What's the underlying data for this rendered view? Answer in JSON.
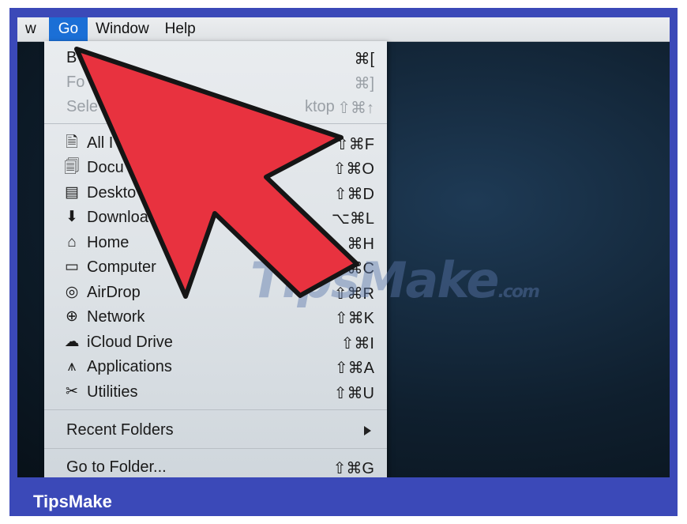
{
  "menubar": {
    "items": [
      "w",
      "Go",
      "Window",
      "Help"
    ]
  },
  "menu": {
    "items": [
      {
        "label": "B",
        "shortcut": "⌘[",
        "dim": false
      },
      {
        "label": "Fo",
        "shortcut": "⌘]",
        "dim": true
      },
      {
        "label": "Sele",
        "label_tail": "ktop",
        "shortcut": "⇧⌘↑",
        "dim": true
      },
      {
        "icon": "all-files-icon",
        "glyph": "🗎",
        "label": "All I",
        "shortcut": "⇧⌘F"
      },
      {
        "icon": "documents-icon",
        "glyph": "🗐",
        "label": "Docu",
        "shortcut": "⇧⌘O"
      },
      {
        "icon": "desktop-icon",
        "glyph": "▤",
        "label": "Deskto",
        "shortcut": "⇧⌘D"
      },
      {
        "icon": "downloads-icon",
        "glyph": "⬇",
        "label": "Downloa",
        "shortcut": "⌥⌘L"
      },
      {
        "icon": "home-icon",
        "glyph": "⌂",
        "label": "Home",
        "shortcut": "⌘H"
      },
      {
        "icon": "computer-icon",
        "glyph": "▭",
        "label": "Computer",
        "shortcut": "⌘C"
      },
      {
        "icon": "airdrop-icon",
        "glyph": "◎",
        "label": "AirDrop",
        "shortcut": "⇧⌘R"
      },
      {
        "icon": "network-icon",
        "glyph": "⊕",
        "label": "Network",
        "shortcut": "⇧⌘K"
      },
      {
        "icon": "icloud-icon",
        "glyph": "☁",
        "label": "iCloud Drive",
        "shortcut": "⇧⌘I"
      },
      {
        "icon": "applications-icon",
        "glyph": "⩚",
        "label": "Applications",
        "shortcut": "⇧⌘A"
      },
      {
        "icon": "utilities-icon",
        "glyph": "✂",
        "label": "Utilities",
        "shortcut": "⇧⌘U"
      },
      {
        "label": "Recent Folders",
        "submenu": true
      },
      {
        "label": "Go to Folder...",
        "shortcut": "⇧⌘G"
      }
    ]
  },
  "watermark": {
    "text": "TipsMake",
    "suffix": ".com"
  },
  "caption": "TipsMake",
  "colors": {
    "frame": "#3b49b8",
    "arrow": "#e8323f",
    "menu_highlight": "#1b6fd6"
  }
}
